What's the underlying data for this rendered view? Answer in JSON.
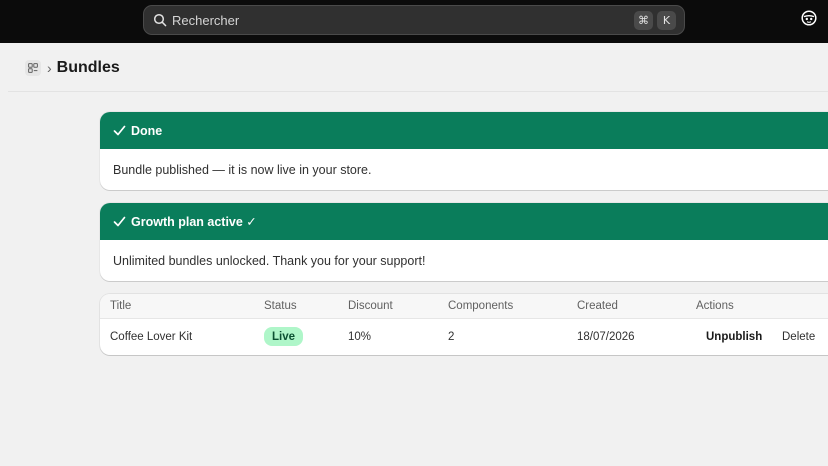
{
  "search": {
    "placeholder": "Rechercher",
    "shortcut_keys": [
      "⌘",
      "K"
    ]
  },
  "page": {
    "title": "Bundles"
  },
  "banners": [
    {
      "title": "Done",
      "message": "Bundle published — it is now live in your store."
    },
    {
      "title": "Growth plan active ✓",
      "message": "Unlimited bundles unlocked. Thank you for your support!"
    }
  ],
  "table": {
    "headers": [
      "Title",
      "Status",
      "Discount",
      "Components",
      "Created",
      "Actions"
    ],
    "rows": [
      {
        "title": "Coffee Lover Kit",
        "status": "Live",
        "discount": "10%",
        "components": "2",
        "created": "18/07/2026",
        "actions": {
          "unpublish": "Unpublish",
          "delete": "Delete"
        }
      }
    ]
  },
  "colors": {
    "topbar": "#0b0b0b",
    "banner_success": "#0a7d5b",
    "badge_bg": "#aff6c9",
    "badge_text": "#0c5132"
  },
  "icons": {
    "search": "search-icon",
    "avatar": "user-avatar-icon",
    "breadcrumb": "bundles-icon",
    "banner": "checkmark-icon"
  }
}
